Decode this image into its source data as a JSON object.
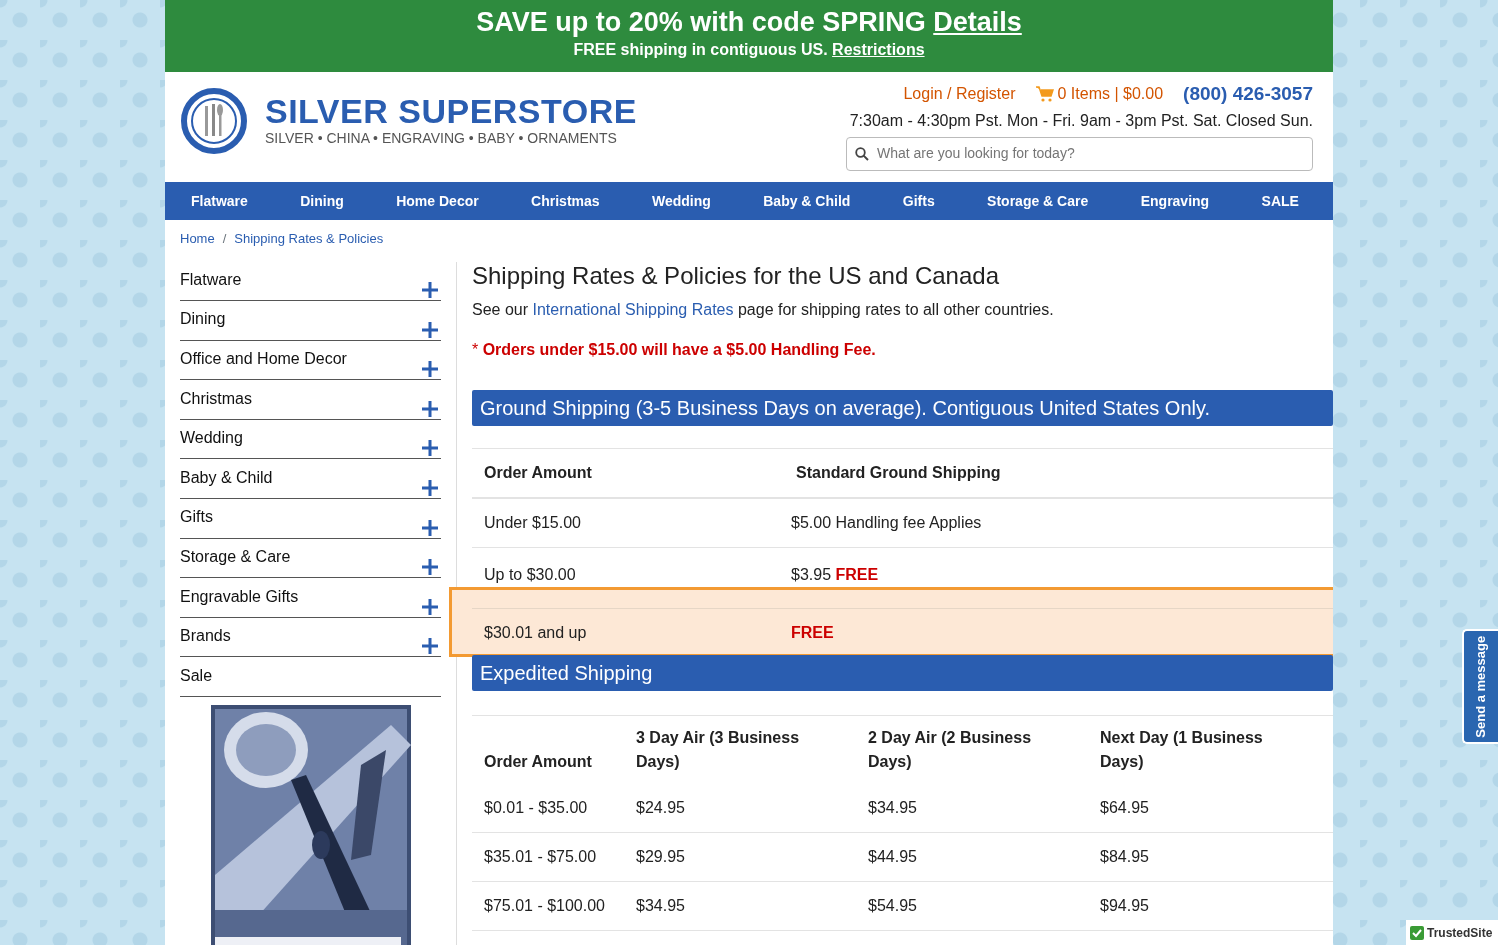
{
  "promo": {
    "headline": "SAVE up to 20% with code SPRING",
    "headline_link": "Details",
    "subline": "FREE shipping in contiguous US.",
    "subline_link": "Restrictions"
  },
  "header": {
    "logo_title": "SILVER SUPERSTORE",
    "logo_tagline": "SILVER • CHINA • ENGRAVING • BABY • ORNAMENTS",
    "login": "Login / Register",
    "cart": "0 Items | $0.00",
    "phone": "(800) 426-3057",
    "hours": "7:30am - 4:30pm Pst. Mon - Fri. 9am - 3pm Pst. Sat. Closed Sun.",
    "search": {
      "placeholder": "What are you looking for today?"
    }
  },
  "nav": [
    "Flatware",
    "Dining",
    "Home Decor",
    "Christmas",
    "Wedding",
    "Baby & Child",
    "Gifts",
    "Storage & Care",
    "Engraving",
    "SALE"
  ],
  "breadcrumb": {
    "separator": "/",
    "items": [
      "Home",
      "Shipping Rates & Policies"
    ]
  },
  "sidebar": {
    "items": [
      {
        "label": "Flatware",
        "expandable": true
      },
      {
        "label": "Dining",
        "expandable": true
      },
      {
        "label": "Office and Home Decor",
        "expandable": true
      },
      {
        "label": "Christmas",
        "expandable": true
      },
      {
        "label": "Wedding",
        "expandable": true
      },
      {
        "label": "Baby & Child",
        "expandable": true
      },
      {
        "label": "Gifts",
        "expandable": true
      },
      {
        "label": "Storage & Care",
        "expandable": true
      },
      {
        "label": "Engravable Gifts",
        "expandable": true
      },
      {
        "label": "Brands",
        "expandable": true
      },
      {
        "label": "Sale",
        "expandable": false
      }
    ]
  },
  "main": {
    "title": "Shipping Rates & Policies for the US and Canada",
    "intro_before": "See our",
    "intro_link": "International Shipping Rates",
    "intro_after": "page for shipping rates to all other countries.",
    "note_mark": "*",
    "note": "Orders under $15.00 will have a $5.00 Handling Fee.",
    "ground": {
      "title": "Ground Shipping (3-5 Business Days on average). Contiguous United States Only.",
      "columns": [
        "Order Amount",
        "Standard Ground Shipping"
      ],
      "rows": [
        {
          "amount": "Under $15.00",
          "price": "$5.00 Handling fee Applies",
          "free": "",
          "highlighted": false
        },
        {
          "amount": "Up to $30.00",
          "price": "$3.95",
          "free": "FREE",
          "highlighted": false
        },
        {
          "amount": "$30.01 and up",
          "price": "",
          "free": "FREE",
          "highlighted": true
        }
      ]
    },
    "expedited": {
      "title": "Expedited Shipping",
      "columns": [
        "Order Amount",
        "3 Day Air (3 Business Days)",
        "2 Day Air (2 Business Days)",
        "Next Day (1 Business Days)"
      ],
      "rows": [
        [
          "$0.01 - $35.00",
          "$24.95",
          "$34.95",
          "$64.95"
        ],
        [
          "$35.01 - $75.00",
          "$29.95",
          "$44.95",
          "$84.95"
        ],
        [
          "$75.01 - $100.00",
          "$34.95",
          "$54.95",
          "$94.95"
        ]
      ]
    }
  },
  "widgets": {
    "message": "Send a message",
    "trusted": "TrustedSite"
  }
}
